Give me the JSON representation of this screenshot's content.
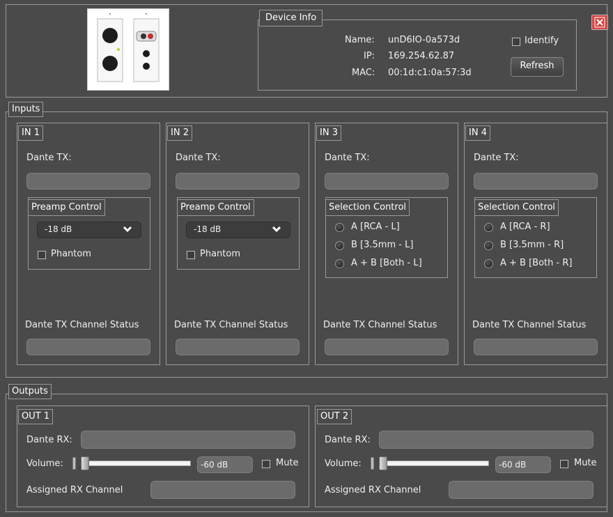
{
  "colors": {
    "background": "#4a4a4a",
    "border": "#9a9a9a",
    "field": "#6b6b6b",
    "close": "#d64545"
  },
  "device_image": {
    "icon": "wall-plate-icon"
  },
  "device_info": {
    "title": "Device Info",
    "name_label": "Name:",
    "name_value": "unD6IO-0a573d",
    "ip_label": "IP:",
    "ip_value": "169.254.62.87",
    "mac_label": "MAC:",
    "mac_value": "00:1d:c1:0a:57:3d",
    "identify_label": "Identify",
    "refresh_label": "Refresh"
  },
  "close_icon": "close-icon",
  "inputs": {
    "title": "Inputs",
    "channels": [
      {
        "title": "IN 1",
        "dante_tx_label": "Dante TX:",
        "control_title": "Preamp Control",
        "gain_value": "-18 dB",
        "phantom_label": "Phantom",
        "status_label": "Dante TX Channel Status"
      },
      {
        "title": "IN 2",
        "dante_tx_label": "Dante TX:",
        "control_title": "Preamp Control",
        "gain_value": "-18 dB",
        "phantom_label": "Phantom",
        "status_label": "Dante TX Channel Status"
      },
      {
        "title": "IN 3",
        "dante_tx_label": "Dante TX:",
        "control_title": "Selection Control",
        "options": [
          "A [RCA - L]",
          "B [3.5mm - L]",
          "A + B [Both - L]"
        ],
        "status_label": "Dante TX Channel Status"
      },
      {
        "title": "IN 4",
        "dante_tx_label": "Dante TX:",
        "control_title": "Selection Control",
        "options": [
          "A [RCA - R]",
          "B [3.5mm - R]",
          "A + B [Both - R]"
        ],
        "status_label": "Dante TX Channel Status"
      }
    ]
  },
  "outputs": {
    "title": "Outputs",
    "channels": [
      {
        "title": "OUT 1",
        "dante_rx_label": "Dante RX:",
        "volume_label": "Volume:",
        "volume_value": "-60 dB",
        "volume_level": 0.0,
        "mute_label": "Mute",
        "assigned_label": "Assigned RX Channel"
      },
      {
        "title": "OUT 2",
        "dante_rx_label": "Dante RX:",
        "volume_label": "Volume:",
        "volume_value": "-60 dB",
        "volume_level": 0.0,
        "mute_label": "Mute",
        "assigned_label": "Assigned RX Channel"
      }
    ]
  }
}
